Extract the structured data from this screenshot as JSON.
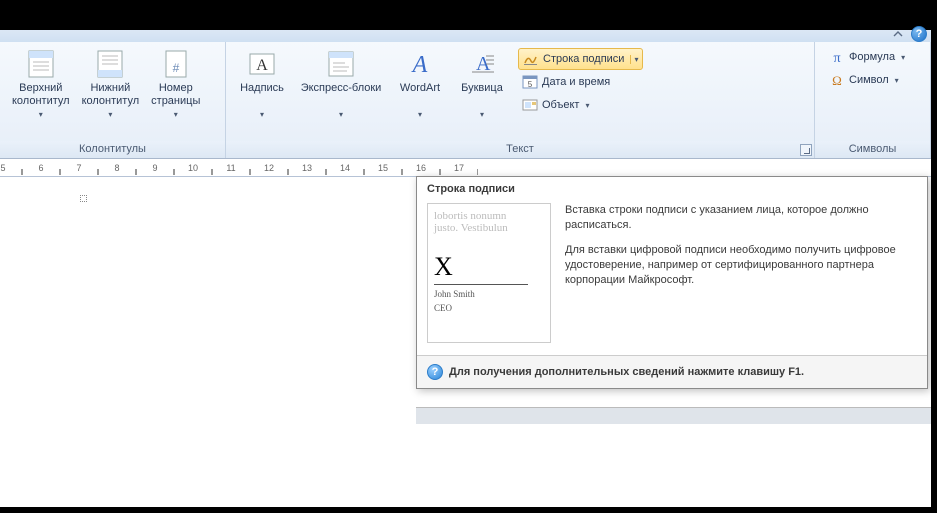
{
  "titlebar": {
    "help": "?",
    "chevron": "⌃"
  },
  "ribbon": {
    "groups": {
      "headers_footers": {
        "label": "Колонтитулы",
        "header_btn": "Верхний\nколонтитул",
        "footer_btn": "Нижний\nколонтитул",
        "page_number_btn": "Номер\nстраницы"
      },
      "text": {
        "label": "Текст",
        "textbox_btn": "Надпись",
        "quickparts_btn": "Экспресс-блоки",
        "wordart_btn": "WordArt",
        "dropcap_btn": "Буквица",
        "signature_line_btn": "Строка подписи",
        "date_time_btn": "Дата и время",
        "object_btn": "Объект"
      },
      "symbols": {
        "label": "Символы",
        "equation_btn": "Формула",
        "symbol_btn": "Символ"
      }
    }
  },
  "ruler": {
    "marks": [
      "5",
      "6",
      "7",
      "8",
      "9",
      "10",
      "11",
      "12",
      "13",
      "14",
      "15",
      "16",
      "17"
    ]
  },
  "tooltip": {
    "title": "Строка подписи",
    "thumb": {
      "faded1": "lobortis nonumn",
      "faded2": "justo. Vestibulun",
      "x": "X",
      "name": "John Smith",
      "role": "CEO"
    },
    "para1": "Вставка строки подписи с указанием лица, которое должно расписаться.",
    "para2": "Для вставки цифровой подписи необходимо получить цифровое удостоверение, например от сертифицированного партнера корпорации Майкрософт.",
    "footer": "Для получения дополнительных сведений нажмите клавишу F1."
  }
}
